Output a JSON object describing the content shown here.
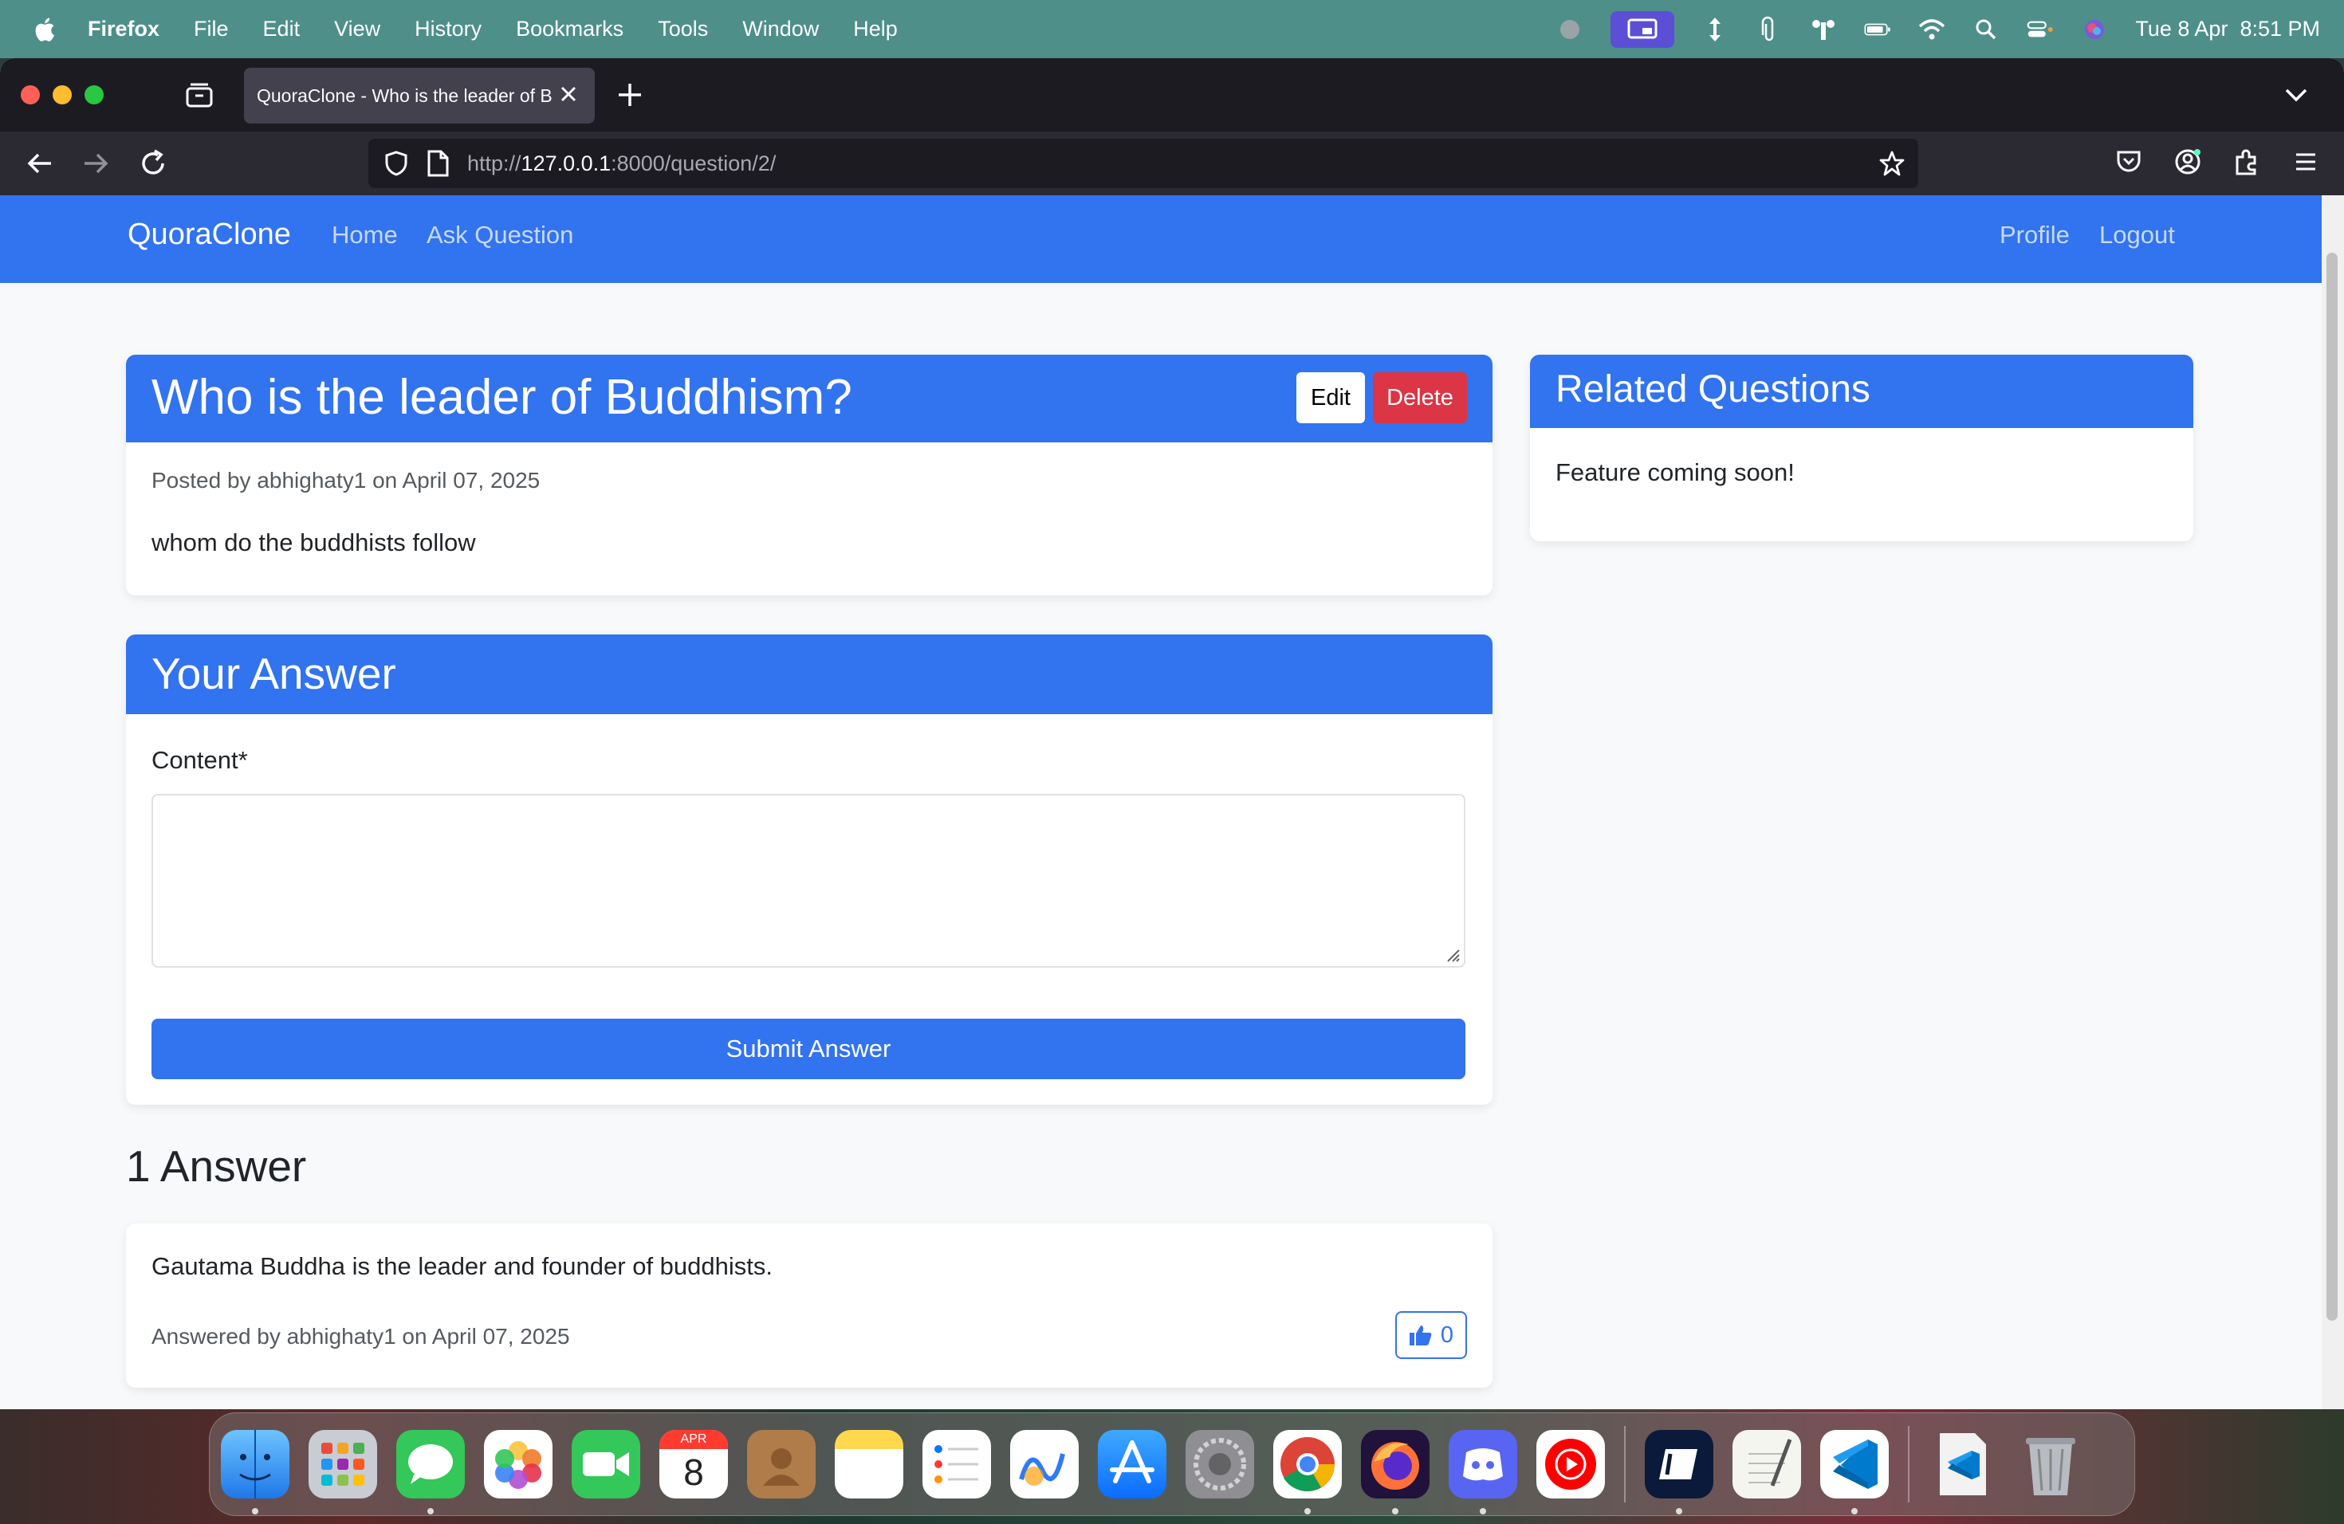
{
  "menubar": {
    "app_name": "Firefox",
    "items": [
      "File",
      "Edit",
      "View",
      "History",
      "Bookmarks",
      "Tools",
      "Window",
      "Help"
    ],
    "clock": "Tue 8 Apr  8:51 PM"
  },
  "browser": {
    "tab_title": "QuoraClone - Who is the leader of B",
    "url_prefix": "http://",
    "url_host": "127.0.0.1",
    "url_rest": ":8000/question/2/"
  },
  "site": {
    "brand": "QuoraClone",
    "nav_left": [
      "Home",
      "Ask Question"
    ],
    "nav_right": [
      "Profile",
      "Logout"
    ]
  },
  "question": {
    "title": "Who is the leader of Buddhism?",
    "edit_label": "Edit",
    "delete_label": "Delete",
    "meta": "Posted by abhighaty1 on April 07, 2025",
    "body": "whom do the buddhists follow"
  },
  "answer_form": {
    "heading": "Your Answer",
    "content_label": "Content*",
    "content_value": "",
    "submit_label": "Submit Answer"
  },
  "answers": {
    "heading": "1 Answer",
    "items": [
      {
        "text": "Gautama Buddha is the leader and founder of buddhists.",
        "meta": "Answered by abhighaty1 on April 07, 2025",
        "likes": "0"
      }
    ]
  },
  "related": {
    "heading": "Related Questions",
    "body": "Feature coming soon!"
  },
  "dock": {
    "calendar_month": "APR",
    "calendar_day": "8"
  },
  "colors": {
    "primary": "#3273ef",
    "danger": "#dc3545",
    "page_bg": "#f8f9fa"
  }
}
